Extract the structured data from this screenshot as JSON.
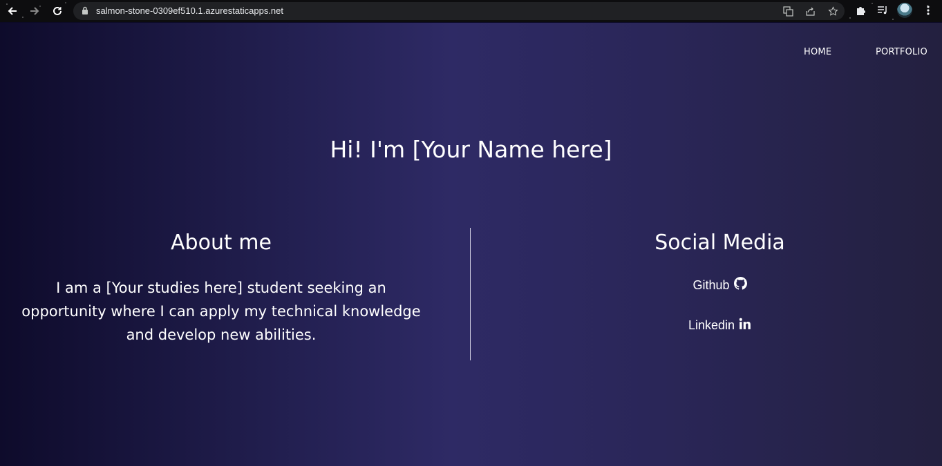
{
  "browser": {
    "url": "salmon-stone-0309ef510.1.azurestaticapps.net",
    "icons": [
      "back-icon",
      "forward-icon",
      "reload-icon",
      "lock-icon",
      "translate-icon",
      "share-icon",
      "star-icon",
      "extensions-icon",
      "media-icon",
      "profile-avatar",
      "menu-icon"
    ]
  },
  "nav": {
    "home": "HOME",
    "portfolio": "PORTFOLIO"
  },
  "hero": {
    "title": "Hi! I'm [Your Name here]"
  },
  "about": {
    "title": "About me",
    "text": "I am a [Your studies here] student seeking an opportunity where I can apply my technical knowledge and develop new abilities."
  },
  "social": {
    "title": "Social Media",
    "links": [
      {
        "label": "Github",
        "icon": "github-icon"
      },
      {
        "label": "Linkedin",
        "icon": "linkedin-icon"
      }
    ]
  },
  "colors": {
    "gradient_left": "#0e0b2b",
    "gradient_mid": "#2e2a65",
    "gradient_right": "#23203f",
    "text": "#ffffff"
  }
}
